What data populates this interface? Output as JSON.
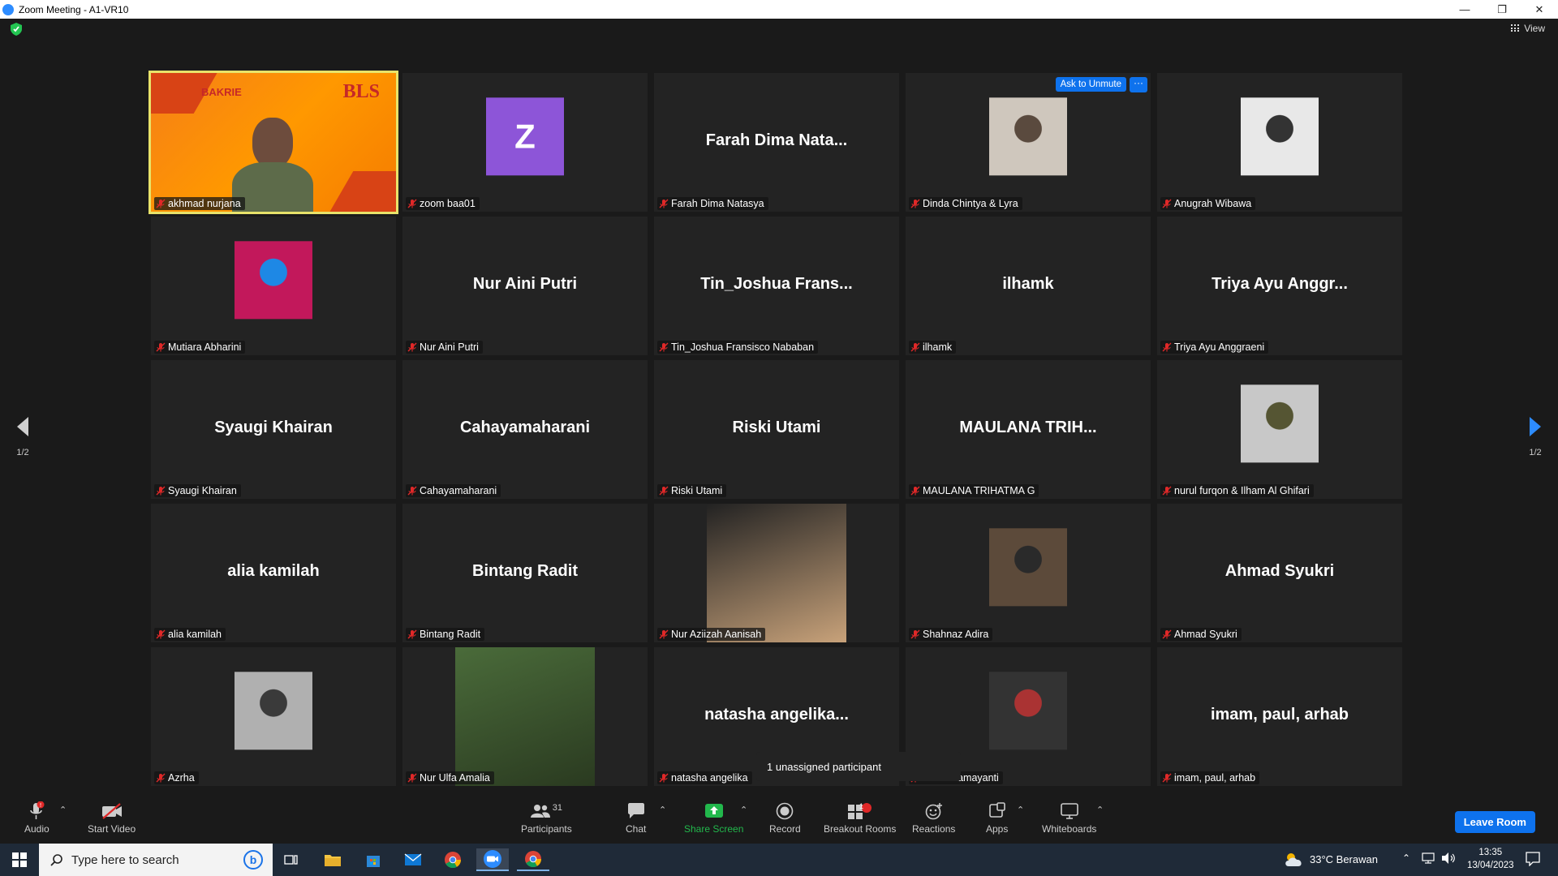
{
  "window": {
    "title": "Zoom Meeting - A1-VR10"
  },
  "header": {
    "view_label": "View"
  },
  "nav": {
    "prev_page": "1/2",
    "next_page": "1/2"
  },
  "tile_controls": {
    "ask_to_unmute": "Ask to Unmute",
    "more": "···"
  },
  "participants": [
    {
      "display": "",
      "label": "akhmad nurjana",
      "type": "video"
    },
    {
      "display": "Z",
      "label": "zoom baa01",
      "type": "avatar"
    },
    {
      "display": "Farah Dima Nata...",
      "label": "Farah Dima Natasya",
      "type": "name"
    },
    {
      "display": "",
      "label": "Dinda Chintya & Lyra",
      "type": "photo"
    },
    {
      "display": "",
      "label": "Anugrah Wibawa",
      "type": "photo"
    },
    {
      "display": "",
      "label": "Mutiara Abharini",
      "type": "photo"
    },
    {
      "display": "Nur Aini Putri",
      "label": "Nur Aini Putri",
      "type": "name"
    },
    {
      "display": "Tin_Joshua  Frans...",
      "label": "Tin_Joshua Fransisco Nababan",
      "type": "name"
    },
    {
      "display": "ilhamk",
      "label": "ilhamk",
      "type": "name"
    },
    {
      "display": "Triya Ayu Anggr...",
      "label": "Triya Ayu Anggraeni",
      "type": "name"
    },
    {
      "display": "Syaugi Khairan",
      "label": "Syaugi Khairan",
      "type": "name"
    },
    {
      "display": "Cahayamaharani",
      "label": "Cahayamaharani",
      "type": "name"
    },
    {
      "display": "Riski Utami",
      "label": "Riski Utami",
      "type": "name"
    },
    {
      "display": "MAULANA  TRIH...",
      "label": "MAULANA TRIHATMA G",
      "type": "name"
    },
    {
      "display": "",
      "label": "nurul furqon & Ilham Al Ghifari",
      "type": "photo"
    },
    {
      "display": "alia kamilah",
      "label": "alia kamilah",
      "type": "name"
    },
    {
      "display": "Bintang Radit",
      "label": "Bintang Radit",
      "type": "name"
    },
    {
      "display": "",
      "label": "Nur Aziizah Aanisah",
      "type": "tallphoto"
    },
    {
      "display": "",
      "label": "Shahnaz Adira",
      "type": "photo"
    },
    {
      "display": "Ahmad Syukri",
      "label": "Ahmad Syukri",
      "type": "name"
    },
    {
      "display": "",
      "label": "Azrha",
      "type": "photo"
    },
    {
      "display": "",
      "label": "Nur Ulfa Amalia",
      "type": "tallphoto"
    },
    {
      "display": "natasha  angelika...",
      "label": "natasha angelika",
      "type": "name"
    },
    {
      "display": "",
      "label": "uthfia Damayanti",
      "type": "photo"
    },
    {
      "display": "imam, paul, arhab",
      "label": "imam, paul, arhab",
      "type": "name"
    }
  ],
  "video_overlay": {
    "logo_left": "BAKRIE",
    "logo_right": "BLS"
  },
  "tooltip": {
    "text": "1 unassigned participant"
  },
  "toolbar": {
    "audio": "Audio",
    "start_video": "Start Video",
    "participants": "Participants",
    "participants_count": "31",
    "chat": "Chat",
    "share_screen": "Share Screen",
    "record": "Record",
    "breakout_rooms": "Breakout Rooms",
    "breakout_badge": "1",
    "reactions": "Reactions",
    "apps": "Apps",
    "whiteboards": "Whiteboards",
    "leave_room": "Leave Room",
    "audio_badge": "!"
  },
  "taskbar": {
    "search_placeholder": "Type here to search",
    "weather": "33°C  Berawan",
    "time": "13:35",
    "date": "13/04/2023"
  },
  "colors": {
    "accent": "#0e72ed",
    "active_speaker": "#e8e36a",
    "muted": "#e02828",
    "share_green": "#22b84c"
  }
}
